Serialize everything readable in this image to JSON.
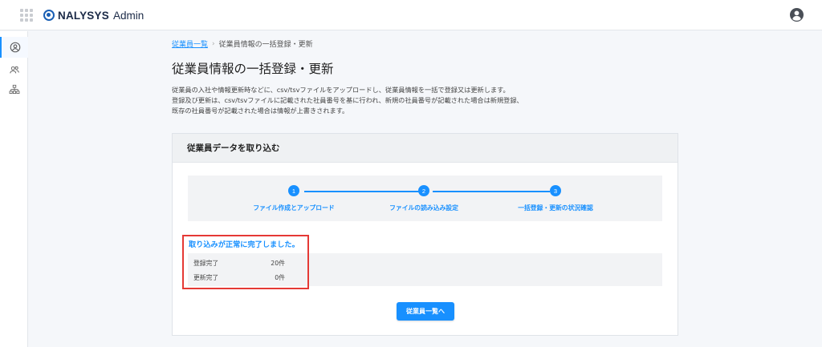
{
  "header": {
    "brand_name": "NALYSYS",
    "brand_sub": "Admin",
    "icons": {
      "apps": "apps-grid-icon",
      "user": "user-avatar-icon"
    }
  },
  "sidebar": {
    "items": [
      {
        "icon": "person-circle-icon",
        "active": true
      },
      {
        "icon": "people-icon",
        "active": false
      },
      {
        "icon": "org-chart-icon",
        "active": false
      }
    ]
  },
  "breadcrumb": {
    "parent": "従業員一覧",
    "separator": "›",
    "current": "従業員情報の一括登録・更新"
  },
  "page": {
    "title": "従業員情報の一括登録・更新",
    "description": [
      "従業員の入社や情報更新時などに、csv/tsvファイルをアップロードし、従業員情報を一括で登録又は更新します。",
      "登録及び更新は、csv/tsvファイルに記載された社員番号を基に行われ、新規の社員番号が記載された場合は新規登録、",
      "既存の社員番号が記載された場合は情報が上書きされます。"
    ]
  },
  "card": {
    "title": "従業員データを取り込む",
    "steps": [
      {
        "number": "1",
        "label": "ファイル作成とアップロード"
      },
      {
        "number": "2",
        "label": "ファイルの読み込み設定"
      },
      {
        "number": "3",
        "label": "一括登録・更新の状況確認"
      }
    ],
    "completion_message": "取り込みが正常に完了しました。",
    "results": [
      {
        "label": "登録完了",
        "value": "20件"
      },
      {
        "label": "更新完了",
        "value": "0件"
      }
    ],
    "button_label": "従業員一覧へ"
  },
  "colors": {
    "accent": "#1890ff",
    "highlight": "#e53935"
  }
}
